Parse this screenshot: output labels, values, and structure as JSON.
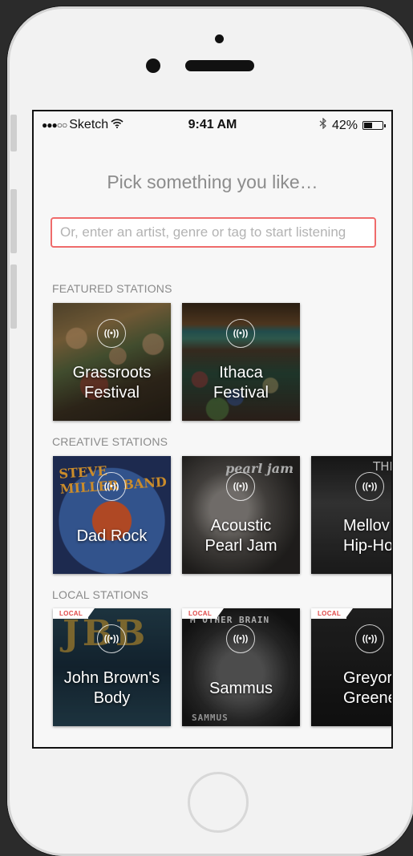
{
  "status_bar": {
    "signal": "●●●○○",
    "carrier": "Sketch",
    "time": "9:41 AM",
    "bluetooth": "bluetooth-icon",
    "battery_pct": "42%",
    "battery_level": 0.42
  },
  "headline": "Pick something you like…",
  "search": {
    "placeholder": "Or, enter an artist, genre or tag to start listening",
    "value": "",
    "border_color": "#ef6b6b"
  },
  "sections": {
    "featured": {
      "title": "FEATURED STATIONS",
      "tiles": [
        {
          "label": "Grassroots Festival",
          "line1": "Grassroots",
          "line2": "Festival",
          "icon": "radio-broadcast-icon"
        },
        {
          "label": "Ithaca Festival",
          "line1": "Ithaca",
          "line2": "Festival",
          "icon": "radio-broadcast-icon"
        }
      ]
    },
    "creative": {
      "title": "CREATIVE STATIONS",
      "tiles": [
        {
          "line1": "Dad Rock",
          "line2": "",
          "art_text": "STEVE MILLER BAND",
          "icon": "radio-broadcast-icon"
        },
        {
          "line1": "Acoustic",
          "line2": "Pearl Jam",
          "art_text": "pearl jam",
          "icon": "radio-broadcast-icon"
        },
        {
          "line1": "Mellov",
          "line2": "Hip-Ho",
          "art_text": "THE",
          "icon": "radio-broadcast-icon"
        }
      ]
    },
    "local": {
      "title": "LOCAL STATIONS",
      "badge": "LOCAL",
      "tiles": [
        {
          "line1": "John Brown's",
          "line2": "Body",
          "art_text": "JBB",
          "icon": "radio-broadcast-icon"
        },
        {
          "line1": "Sammus",
          "line2": "",
          "art_text": "M'OTHER BRAIN",
          "art_text2": "SAMMUS",
          "icon": "radio-broadcast-icon"
        },
        {
          "line1": "Greyor",
          "line2": "Greene",
          "icon": "radio-broadcast-icon"
        }
      ]
    }
  },
  "radio_glyph": "((•))"
}
